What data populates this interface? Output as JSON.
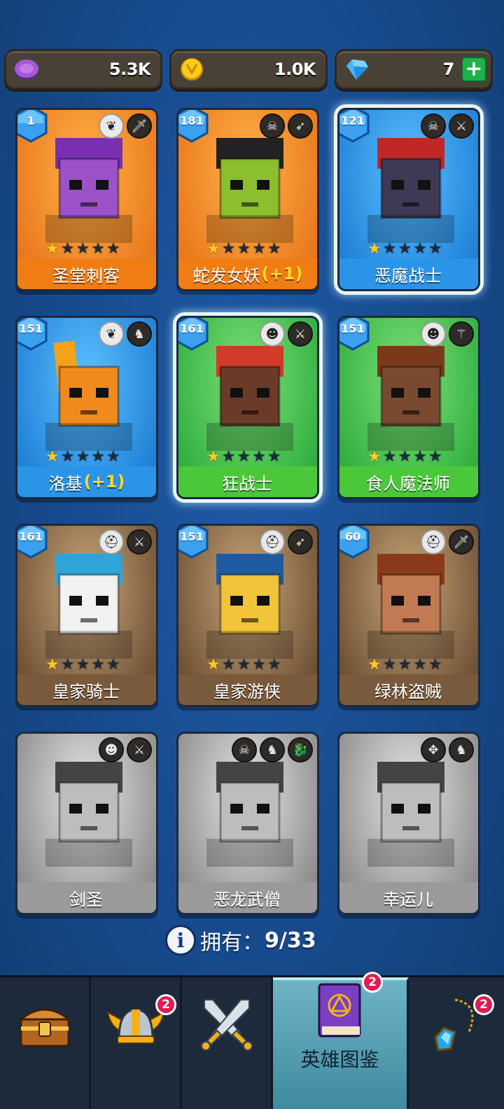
{
  "currencies": {
    "purple": {
      "value": "5.3K",
      "icon": "purple-token-icon"
    },
    "gold": {
      "value": "1.0K",
      "icon": "gold-coin-icon"
    },
    "gems": {
      "value": "7",
      "icon": "gem-icon",
      "plus": "+"
    }
  },
  "heroes": [
    {
      "level": "1",
      "name": "圣堂刺客",
      "extra": "",
      "stars": 1,
      "theme": "orange",
      "badges": [
        "angel-wings-icon",
        "dagger-icon"
      ]
    },
    {
      "level": "181",
      "name": "蛇发女妖",
      "extra": "(+1)",
      "stars": 1,
      "theme": "orange",
      "badges": [
        "skull-icon",
        "bow-icon"
      ]
    },
    {
      "level": "121",
      "name": "恶魔战士",
      "extra": "",
      "stars": 1,
      "theme": "blue",
      "selected": true,
      "badges": [
        "skull-icon",
        "sword-icon"
      ]
    },
    {
      "level": "151",
      "name": "洛基",
      "extra": "(+1)",
      "stars": 1,
      "theme": "blue",
      "badges": [
        "angel-wings-icon",
        "dragon-head-icon"
      ]
    },
    {
      "level": "161",
      "name": "狂战士",
      "extra": "",
      "stars": 1,
      "theme": "green",
      "selected": true,
      "badges": [
        "orc-icon",
        "sword-icon"
      ]
    },
    {
      "level": "151",
      "name": "食人魔法师",
      "extra": "",
      "stars": 1,
      "theme": "green",
      "badges": [
        "orc-icon",
        "staff-icon"
      ]
    },
    {
      "level": "161",
      "name": "皇家骑士",
      "extra": "",
      "stars": 1,
      "theme": "brown",
      "badges": [
        "helmet-icon",
        "sword-icon"
      ]
    },
    {
      "level": "151",
      "name": "皇家游侠",
      "extra": "",
      "stars": 1,
      "theme": "brown",
      "badges": [
        "helmet-icon",
        "bow-icon"
      ]
    },
    {
      "level": "60",
      "name": "绿林盗贼",
      "extra": "",
      "stars": 1,
      "theme": "brown",
      "badges": [
        "helmet-icon",
        "dagger-icon"
      ]
    },
    {
      "level": "",
      "name": "剑圣",
      "extra": "",
      "stars": 0,
      "theme": "gray",
      "badges": [
        "orc-icon",
        "sword-icon"
      ]
    },
    {
      "level": "",
      "name": "恶龙武僧",
      "extra": "",
      "stars": 0,
      "theme": "gray",
      "badges": [
        "skull-icon",
        "dragon-head-icon",
        "dragon-icon"
      ]
    },
    {
      "level": "",
      "name": "幸运儿",
      "extra": "",
      "stars": 0,
      "theme": "gray",
      "badges": [
        "elf-icon",
        "dragon-head-icon"
      ]
    }
  ],
  "owned": {
    "label": "拥有：",
    "count": "9/33"
  },
  "nav": {
    "tabs": [
      {
        "icon": "treasure-chest-icon",
        "label": "",
        "badge": ""
      },
      {
        "icon": "viking-helmet-icon",
        "label": "",
        "badge": "2"
      },
      {
        "icon": "crossed-swords-icon",
        "label": "",
        "badge": ""
      },
      {
        "icon": "hero-book-icon",
        "label": "英雄图鉴",
        "badge": "2",
        "active": true
      },
      {
        "icon": "amulet-icon",
        "label": "",
        "badge": "2"
      }
    ]
  },
  "colors": {
    "orange": "#f08a1c",
    "blue": "#2e96e6",
    "green": "#3fc24a",
    "brown": "#7a5a3c",
    "gray": "#9a9a9a",
    "bg": "#174a8c",
    "gem_plus": "#1fb24b",
    "notif": "#e01c52"
  }
}
